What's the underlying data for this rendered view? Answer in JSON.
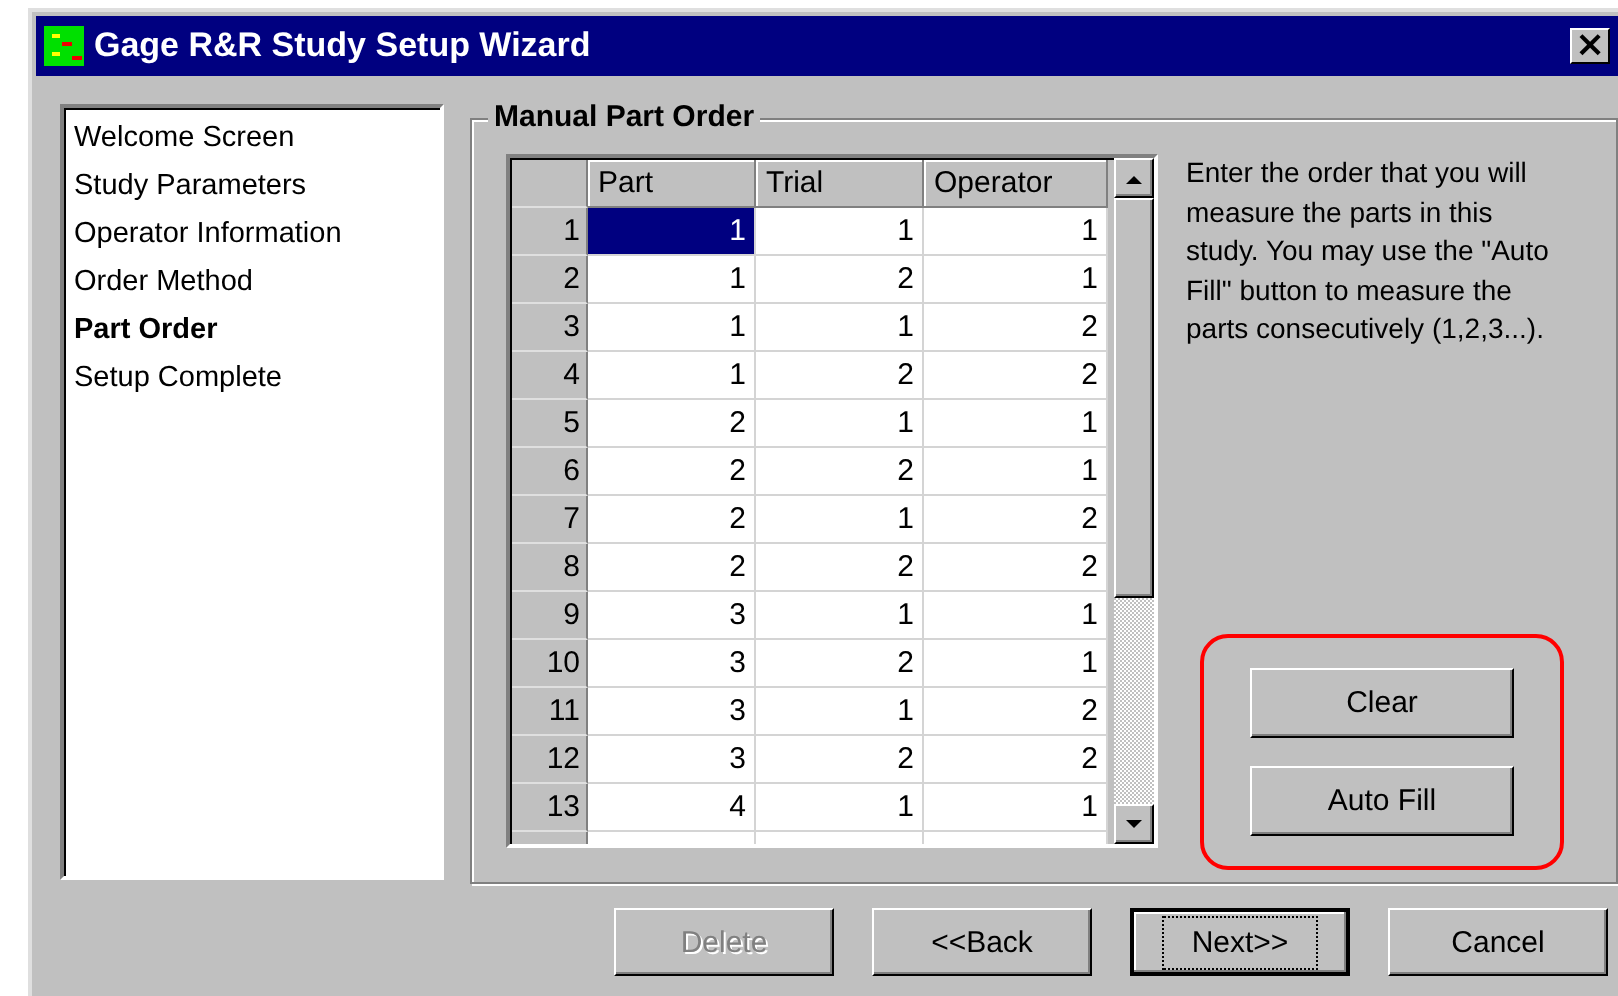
{
  "window": {
    "title": "Gage R&R Study Setup Wizard",
    "close": "×"
  },
  "steps": [
    {
      "label": "Welcome Screen",
      "selected": false
    },
    {
      "label": "Study Parameters",
      "selected": false
    },
    {
      "label": "Operator Information",
      "selected": false
    },
    {
      "label": "Order Method",
      "selected": false
    },
    {
      "label": "Part Order",
      "selected": true
    },
    {
      "label": "Setup Complete",
      "selected": false
    }
  ],
  "group_title": "Manual Part Order",
  "table": {
    "columns": [
      "Part",
      "Trial",
      "Operator"
    ],
    "rows": [
      {
        "index": "1",
        "cells": [
          "1",
          "1",
          "1"
        ],
        "selected": true
      },
      {
        "index": "2",
        "cells": [
          "1",
          "2",
          "1"
        ],
        "selected": false
      },
      {
        "index": "3",
        "cells": [
          "1",
          "1",
          "2"
        ],
        "selected": false
      },
      {
        "index": "4",
        "cells": [
          "1",
          "2",
          "2"
        ],
        "selected": false
      },
      {
        "index": "5",
        "cells": [
          "2",
          "1",
          "1"
        ],
        "selected": false
      },
      {
        "index": "6",
        "cells": [
          "2",
          "2",
          "1"
        ],
        "selected": false
      },
      {
        "index": "7",
        "cells": [
          "2",
          "1",
          "2"
        ],
        "selected": false
      },
      {
        "index": "8",
        "cells": [
          "2",
          "2",
          "2"
        ],
        "selected": false
      },
      {
        "index": "9",
        "cells": [
          "3",
          "1",
          "1"
        ],
        "selected": false
      },
      {
        "index": "10",
        "cells": [
          "3",
          "2",
          "1"
        ],
        "selected": false
      },
      {
        "index": "11",
        "cells": [
          "3",
          "1",
          "2"
        ],
        "selected": false
      },
      {
        "index": "12",
        "cells": [
          "3",
          "2",
          "2"
        ],
        "selected": false
      },
      {
        "index": "13",
        "cells": [
          "4",
          "1",
          "1"
        ],
        "selected": false
      }
    ]
  },
  "description": "Enter the order that you will measure the parts in this study. You may use the \"Auto Fill\" button to measure the parts consecutively (1,2,3...).",
  "side_buttons": [
    {
      "label": "Clear"
    },
    {
      "label": "Auto Fill"
    }
  ],
  "footer_buttons": [
    {
      "label": "Delete",
      "disabled": true,
      "default": false
    },
    {
      "label": "<<Back",
      "disabled": false,
      "default": false
    },
    {
      "label": "Next>>",
      "disabled": false,
      "default": true
    },
    {
      "label": "Cancel",
      "disabled": false,
      "default": false
    }
  ]
}
